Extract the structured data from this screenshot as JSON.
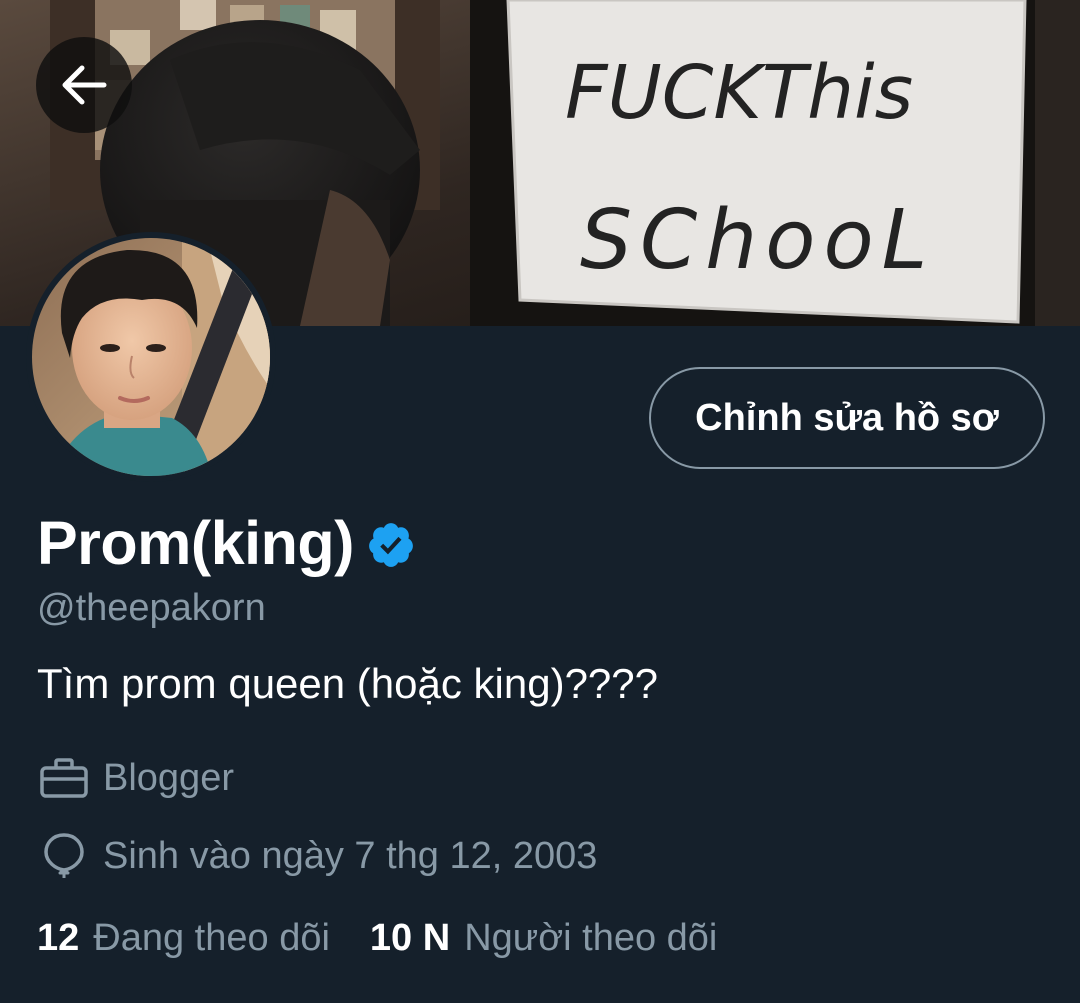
{
  "header": {
    "back_icon": "arrow-left-icon",
    "banner_sign_text_line1": "FUCKThis",
    "banner_sign_text_line2": "SChooL"
  },
  "profile": {
    "edit_button_label": "Chỉnh sửa hồ sơ",
    "display_name": "Prom(king)",
    "verified_icon": "verified-badge-icon",
    "handle": "@theepakorn",
    "bio": "Tìm prom queen (hoặc king)????",
    "occupation": "Blogger",
    "occupation_icon": "briefcase-icon",
    "birthday": "Sinh vào ngày 7 thg 12, 2003",
    "birthday_icon": "balloon-icon"
  },
  "stats": {
    "following_count": "12",
    "following_label": "Đang theo dõi",
    "followers_count": "10 N",
    "followers_label": "Người theo dõi"
  },
  "colors": {
    "background": "#15202b",
    "secondary_text": "#8899a6",
    "verified": "#1da1f2",
    "primary_text": "#ffffff"
  }
}
